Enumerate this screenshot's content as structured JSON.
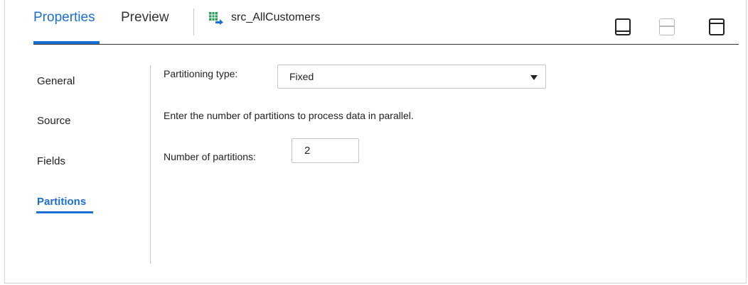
{
  "tabs": {
    "properties": "Properties",
    "preview": "Preview",
    "active": "Properties"
  },
  "object": {
    "name": "src_AllCustomers",
    "icon": "table-source-icon"
  },
  "panel_controls": [
    "panel-bottom-icon",
    "panel-split-icon",
    "panel-maximize-icon"
  ],
  "nav": {
    "items": [
      {
        "label": "General"
      },
      {
        "label": "Source"
      },
      {
        "label": "Fields"
      },
      {
        "label": "Partitions"
      }
    ],
    "selected": "Partitions"
  },
  "content": {
    "partitioning_type_label": "Partitioning type:",
    "partitioning_type_value": "Fixed",
    "hint": "Enter the number of partitions to process data in parallel.",
    "num_partitions_label": "Number of partitions:",
    "num_partitions_value": "2"
  },
  "colors": {
    "accent": "#1a6fd4",
    "text": "#222222",
    "border": "#c4c4c4"
  }
}
